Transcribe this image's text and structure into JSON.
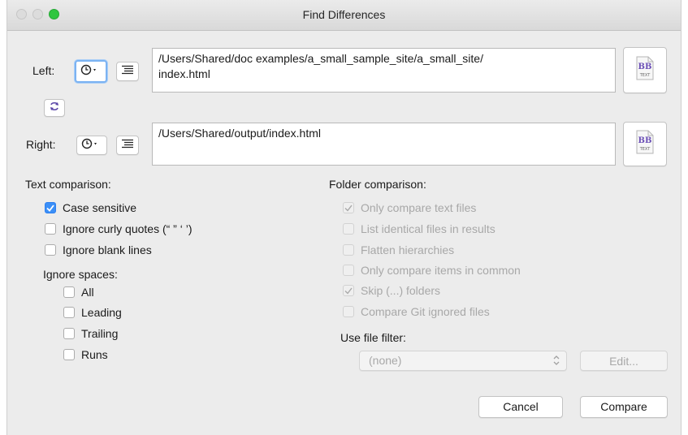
{
  "window": {
    "title": "Find Differences"
  },
  "left": {
    "label": "Left:",
    "path": "/Users/Shared/doc examples/a_small_sample_site/a_small_site/\nindex.html",
    "history_icon": "clock-icon",
    "list_icon": "list-icon",
    "file_icon": "text-file-icon"
  },
  "swap_icon": "swap-arrows-icon",
  "right": {
    "label": "Right:",
    "path": "/Users/Shared/output/index.html",
    "history_icon": "clock-icon",
    "list_icon": "list-icon",
    "file_icon": "text-file-icon"
  },
  "file_icon_caption": "TEXT",
  "text_comparison": {
    "heading": "Text comparison:",
    "options": [
      {
        "label": "Case sensitive",
        "checked": true
      },
      {
        "label": "Ignore curly quotes (“ ” ‘ ’)",
        "checked": false
      },
      {
        "label": "Ignore blank lines",
        "checked": false
      }
    ],
    "spaces_heading": "Ignore spaces:",
    "spaces": [
      {
        "label": "All",
        "checked": false
      },
      {
        "label": "Leading",
        "checked": false
      },
      {
        "label": "Trailing",
        "checked": false
      },
      {
        "label": "Runs",
        "checked": false
      }
    ]
  },
  "folder_comparison": {
    "heading": "Folder comparison:",
    "options": [
      {
        "label": "Only compare text files",
        "checked": true,
        "enabled": false
      },
      {
        "label": "List identical files in results",
        "checked": false,
        "enabled": false
      },
      {
        "label": "Flatten hierarchies",
        "checked": false,
        "enabled": false
      },
      {
        "label": "Only compare items in common",
        "checked": false,
        "enabled": false
      },
      {
        "label": "Skip (...) folders",
        "checked": true,
        "enabled": false
      },
      {
        "label": "Compare Git ignored files",
        "checked": false,
        "enabled": false
      }
    ],
    "filter_label": "Use file filter:",
    "filter_value": "(none)",
    "edit_label": "Edit..."
  },
  "buttons": {
    "cancel": "Cancel",
    "compare": "Compare"
  },
  "colors": {
    "accent": "#3b8ff7",
    "close_light": "#dcdcdc",
    "zoom_light": "#2fc640"
  }
}
